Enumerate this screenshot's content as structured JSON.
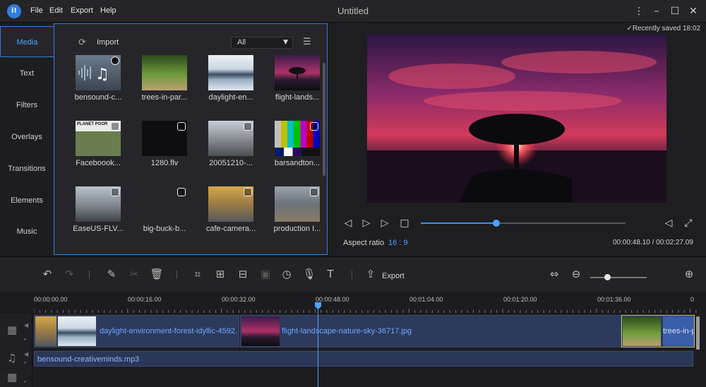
{
  "app": {
    "title": "Untitled",
    "logo_text": "i!"
  },
  "menu": [
    "File",
    "Edit",
    "Export",
    "Help"
  ],
  "window_controls": [
    "more-icon",
    "minimize-icon",
    "maximize-icon",
    "close-icon"
  ],
  "tabs": [
    "Media",
    "Text",
    "Filters",
    "Overlays",
    "Transitions",
    "Elements",
    "Music"
  ],
  "active_tab": "Media",
  "media": {
    "import_label": "Import",
    "filter_value": "All",
    "items": [
      {
        "label": "bensound-c..."
      },
      {
        "label": "trees-in-par..."
      },
      {
        "label": "daylight-en..."
      },
      {
        "label": "flight-lands..."
      },
      {
        "label": "Faceboook...",
        "thumb_text": "PLANET POOR"
      },
      {
        "label": "1280.flv"
      },
      {
        "label": "20051210-..."
      },
      {
        "label": "barsandton..."
      },
      {
        "label": "EaseUS-FLV..."
      },
      {
        "label": "big-buck-b..."
      },
      {
        "label": "cafe-camera..."
      },
      {
        "label": "production I..."
      }
    ]
  },
  "preview": {
    "saved_text": "Recently saved 18:02",
    "aspect_label": "Aspect ratio",
    "aspect_value": "16 : 9",
    "time_display": "00:00:48.10 / 00:02:27.09",
    "progress": 0.37
  },
  "toolbar": {
    "export_label": "Export",
    "zoom_level": 0.3
  },
  "ruler": [
    "00:00:00.00",
    "00:00:16.00",
    "00:00:32.00",
    "00:00:48.00",
    "00:01:04.00",
    "00:01:20.00",
    "00:01:36.00",
    "0"
  ],
  "timeline": {
    "video_clips": [
      {
        "label": "daylight-environment-forest-idyllic-4592."
      },
      {
        "label": "flight-landscape-nature-sky-36717.jpg"
      },
      {
        "label": "trees-in-p"
      }
    ],
    "audio_clip": "bensound-creativeminds.mp3"
  }
}
